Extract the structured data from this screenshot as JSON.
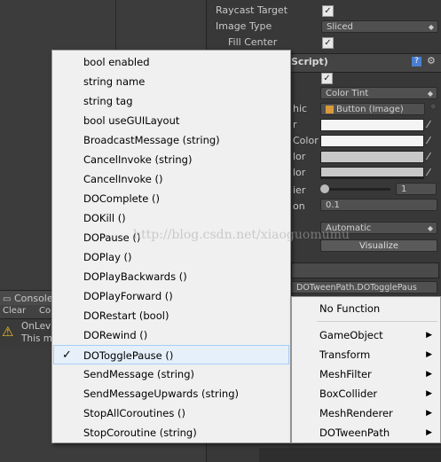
{
  "inspector": {
    "raycast_label": "Raycast Target",
    "image_type_label": "Image Type",
    "image_type_value": "Sliced",
    "fill_center_label": "Fill Center",
    "component_title_fragment": "Script)",
    "transition_value": "Color Tint",
    "target_graphic_fragment": "hic",
    "target_graphic_value": "Button (Image)",
    "normal_color_fragment": "r",
    "highlighted_color_fragment": "Color",
    "pressed_color_fragment": "lor",
    "disabled_color_fragment": "lor",
    "multiplier_fragment": "ier",
    "multiplier_value": "1",
    "fade_fragment": "on",
    "fade_value": "0.1",
    "navigation_value": "Automatic",
    "visualize_label": "Visualize",
    "event_function_value": "DOTweenPath.DOTogglePaus"
  },
  "console": {
    "tab_label": "Console",
    "clear_label": "Clear",
    "collapse_fragment": "Co",
    "msg_line1": "OnLev",
    "msg_line2": "This m"
  },
  "watermark": "http://blog.csdn.net/xiaoguomumu",
  "menu": {
    "items": [
      "bool enabled",
      "string name",
      "string tag",
      "bool useGUILayout",
      "BroadcastMessage (string)",
      "CancelInvoke (string)",
      "CancelInvoke ()",
      "DOComplete ()",
      "DOKill ()",
      "DOPause ()",
      "DOPlay ()",
      "DOPlayBackwards ()",
      "DOPlayForward ()",
      "DORestart (bool)",
      "DORewind ()",
      "DOTogglePause ()",
      "SendMessage (string)",
      "SendMessageUpwards (string)",
      "StopAllCoroutines ()",
      "StopCoroutine (string)"
    ],
    "selected_index": 15
  },
  "submenu": {
    "items": [
      "No Function",
      "GameObject",
      "Transform",
      "MeshFilter",
      "BoxCollider",
      "MeshRenderer",
      "DOTweenPath"
    ]
  },
  "colors": {
    "menu_bg": "#f0f0f0",
    "selection_bg": "#e5f0fb",
    "selection_border": "#a8cdf1",
    "editor_bg": "#383838"
  }
}
